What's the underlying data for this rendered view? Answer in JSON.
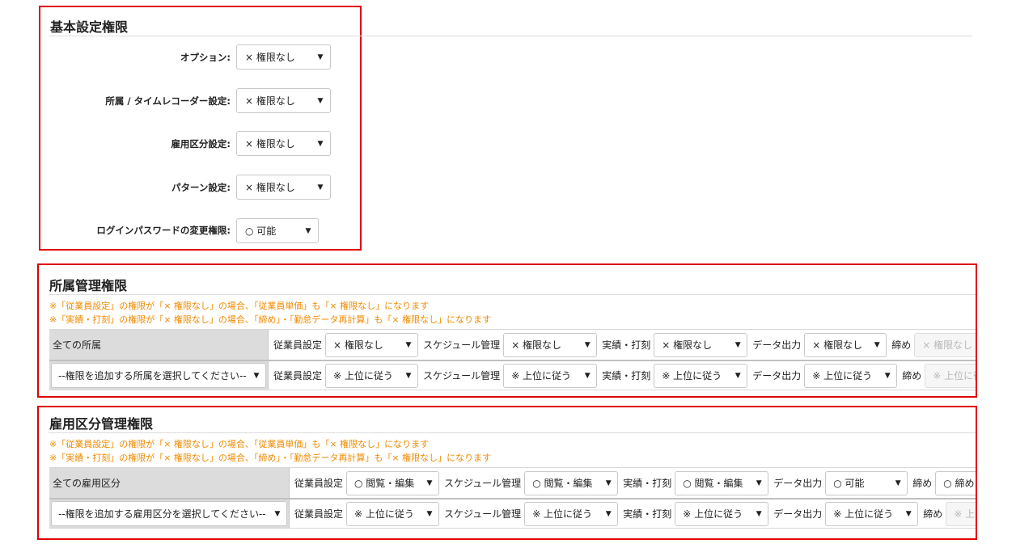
{
  "basic": {
    "title": "基本設定権限",
    "rows": [
      {
        "label": "オプション:",
        "value": "× 権限なし"
      },
      {
        "label": "所属 / タイムレコーダー設定:",
        "value": "× 権限なし"
      },
      {
        "label": "雇用区分設定:",
        "value": "× 権限なし"
      },
      {
        "label": "パターン設定:",
        "value": "× 権限なし"
      },
      {
        "label": "ログインパスワードの変更権限:",
        "value": "○ 可能"
      }
    ],
    "arrow": "▼"
  },
  "dept": {
    "title": "所属管理権限",
    "notes": [
      "※「従業員設定」の権限が「× 権限なし」の場合、「従業員単価」も「× 権限なし」になります",
      "※「実績・打刻」の権限が「× 権限なし」の場合、「締め」・「勤怠データ再計算」も「× 権限なし」になります"
    ],
    "row1_head": "全ての所属",
    "row2_select": "--権限を追加する所属を選択してください--",
    "columns": [
      "従業員設定",
      "スケジュール管理",
      "実績・打刻",
      "データ出力",
      "締め"
    ],
    "row1_values": [
      "× 権限なし",
      "× 権限なし",
      "× 権限なし",
      "× 権限なし",
      "× 権限なし"
    ],
    "row2_values": [
      "※ 上位に従う",
      "※ 上位に従う",
      "※ 上位に従う",
      "※ 上位に従う",
      "※ 上位に従う"
    ]
  },
  "emp": {
    "title": "雇用区分管理権限",
    "notes": [
      "※「従業員設定」の権限が「× 権限なし」の場合、「従業員単価」も「× 権限なし」になります",
      "※「実績・打刻」の権限が「× 権限なし」の場合、「締め」・「勤怠データ再計算」も「× 権限なし」になります"
    ],
    "row1_head": "全ての雇用区分",
    "row2_select": "--権限を追加する雇用区分を選択してください--",
    "columns": [
      "従業員設定",
      "スケジュール管理",
      "実績・打刻",
      "データ出力",
      "締め"
    ],
    "row1_values": [
      "○ 閲覧・編集",
      "○ 閲覧・編集",
      "○ 閲覧・編集",
      "○ 可能",
      "○ 締め・解除"
    ],
    "row2_values": [
      "※ 上位に従う",
      "※ 上位に従う",
      "※ 上位に従う",
      "※ 上位に従う",
      "※ 上位に従う"
    ]
  },
  "colors": {
    "frame": "#e00000",
    "note": "#f08a00"
  }
}
